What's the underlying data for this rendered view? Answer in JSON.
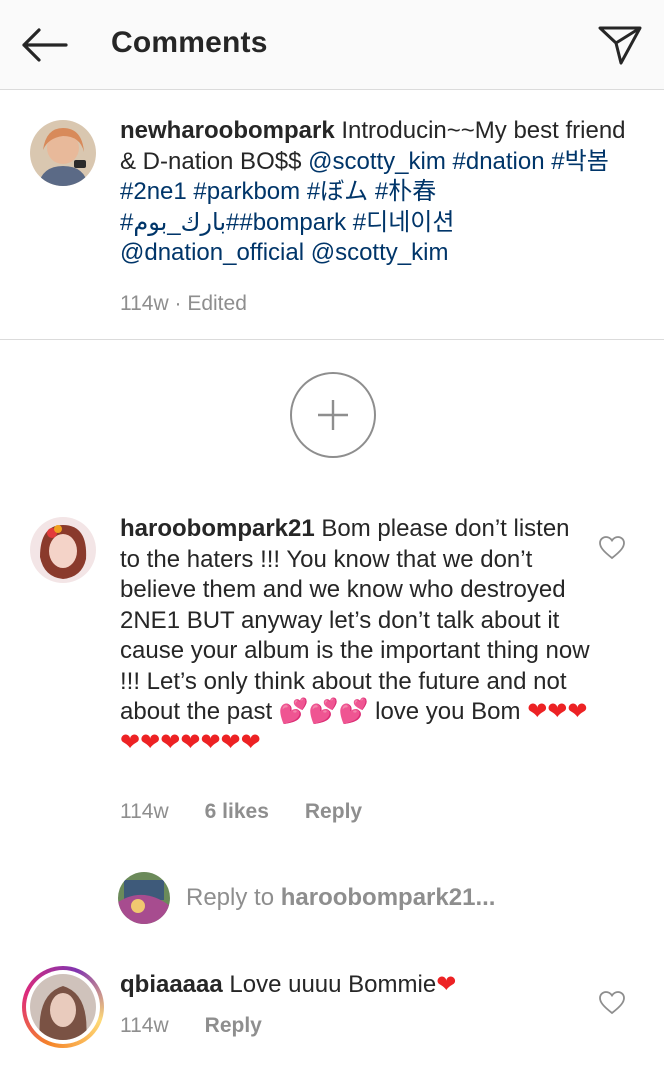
{
  "header": {
    "title": "Comments",
    "back_icon": "arrow-left-icon",
    "send_icon": "paper-plane-icon"
  },
  "caption": {
    "username": "newharoobompark",
    "text_parts": [
      {
        "t": " Introducin~~My best friend & D-nation BO$$ ",
        "link": false
      },
      {
        "t": "@scotty_kim",
        "link": true
      },
      {
        "t": " ",
        "link": false
      },
      {
        "t": "#dnation",
        "link": true
      },
      {
        "t": " ",
        "link": false
      },
      {
        "t": "#박봄",
        "link": true
      },
      {
        "t": " ",
        "link": false
      },
      {
        "t": "#2ne1",
        "link": true
      },
      {
        "t": " ",
        "link": false
      },
      {
        "t": "#parkbom",
        "link": true
      },
      {
        "t": " ",
        "link": false
      },
      {
        "t": "#ぼム",
        "link": true
      },
      {
        "t": " ",
        "link": false
      },
      {
        "t": "#朴春",
        "link": true
      },
      {
        "t": " ",
        "link": false
      },
      {
        "t": "#بارك_بوم",
        "link": true
      },
      {
        "t": "##bompark",
        "link": true
      },
      {
        "t": " ",
        "link": false
      },
      {
        "t": "#디네이션",
        "link": true
      },
      {
        "t": " ",
        "link": false
      },
      {
        "t": "@dnation_official",
        "link": true
      },
      {
        "t": " ",
        "link": false
      },
      {
        "t": "@scotty_kim",
        "link": true
      }
    ],
    "time": "114w",
    "edited": "Edited"
  },
  "load_more_icon": "plus-circle-icon",
  "comments": [
    {
      "username": "haroobompark21",
      "text": " Bom please don’t listen to the haters !!! You know that we don’t believe them and we know who destroyed 2NE1 BUT anyway let’s don’t talk about it cause your album is the important thing now !!! Let’s only think about the future and not about the past 💕💕💕 love you Bom ",
      "hearts": "❤❤❤❤❤❤❤❤❤❤",
      "time": "114w",
      "likes": "6 likes",
      "reply": "Reply"
    },
    {
      "username": "qbiaaaaa",
      "text": " Love uuuu Bommie",
      "hearts": "❤",
      "time": "114w",
      "reply": "Reply"
    }
  ],
  "reply_bar": {
    "prefix": "Reply to ",
    "target": "haroobompark21..."
  },
  "colors": {
    "link": "#003569",
    "meta": "#8e8e8e",
    "heart": "#ed2224",
    "divider": "#dbdbdb"
  }
}
